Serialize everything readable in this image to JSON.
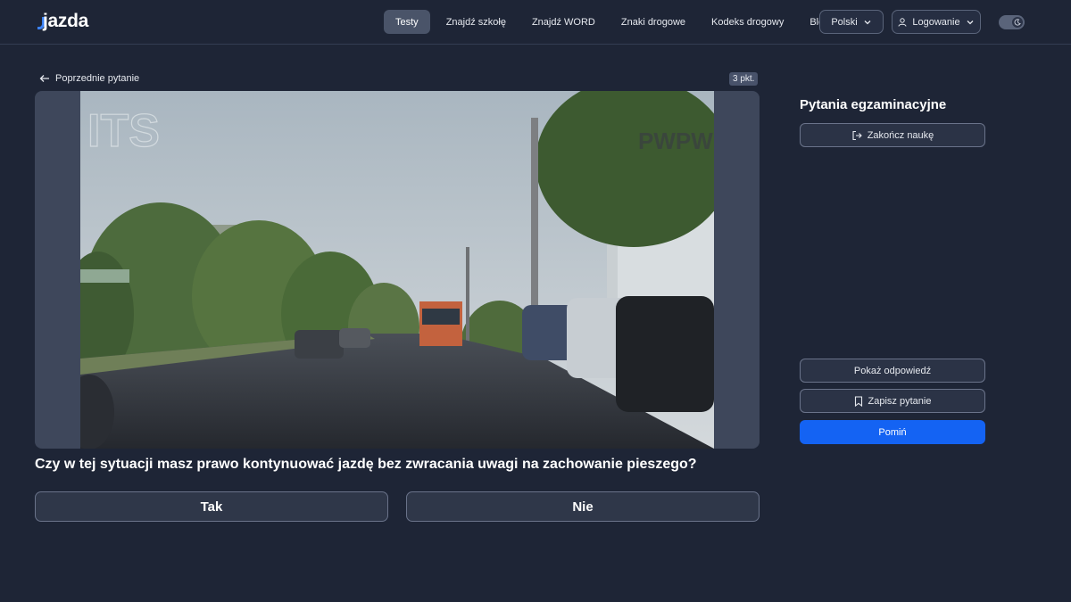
{
  "header": {
    "logo_text": "jazda",
    "nav": [
      {
        "label": "Testy",
        "active": true
      },
      {
        "label": "Znajdź szkołę"
      },
      {
        "label": "Znajdź WORD"
      },
      {
        "label": "Znaki drogowe"
      },
      {
        "label": "Kodeks drogowy"
      },
      {
        "label": "Blog"
      }
    ],
    "language_label": "Polski",
    "login_label": "Logowanie",
    "theme_toggle_icon": "moon-icon"
  },
  "question_view": {
    "prev_label": "Poprzednie pytanie",
    "points": "3 pkt.",
    "media_watermark_left": "ITS",
    "media_watermark_right": "PWPW",
    "question_text": "Czy w tej sytuacji masz prawo kontynuować jazdę bez zwracania uwagi na zachowanie pieszego?",
    "answers": {
      "yes": "Tak",
      "no": "Nie"
    }
  },
  "side_panel": {
    "title": "Pytania egzaminacyjne",
    "finish_label": "Zakończ naukę",
    "show_answer_label": "Pokaż odpowiedź",
    "save_label": "Zapisz pytanie",
    "skip_label": "Pomiń"
  },
  "colors": {
    "background": "#1e2536",
    "accent": "#1463f3"
  }
}
